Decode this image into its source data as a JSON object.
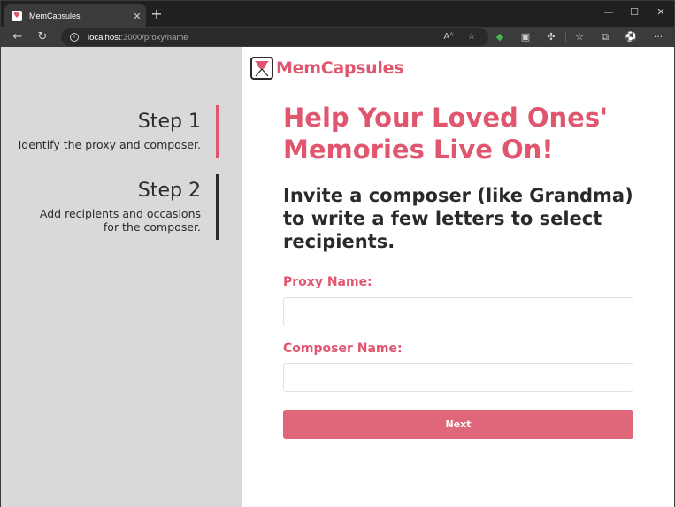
{
  "browser": {
    "tab_title": "MemCapsules",
    "tab_close": "✕",
    "new_tab": "+",
    "window_controls": {
      "minimize": "—",
      "maximize": "☐",
      "close": "✕"
    },
    "nav": {
      "back": "←",
      "refresh": "↻"
    },
    "url_host": "localhost",
    "url_path": ":3000/proxy/name",
    "more_menu": "···"
  },
  "sidebar": {
    "steps": [
      {
        "title": "Step 1",
        "description": "Identify the proxy and composer.",
        "active": true
      },
      {
        "title": "Step 2",
        "description": "Add recipients and occasions for the composer.",
        "active": false
      }
    ]
  },
  "main": {
    "brand": "MemCapsules",
    "hero": "Help Your Loved Ones' Memories Live On!",
    "subtitle": "Invite a composer (like Grandma) to write a few letters to select recipients.",
    "form": {
      "proxy_label": "Proxy Name:",
      "proxy_value": "",
      "composer_label": "Composer Name:",
      "composer_value": "",
      "next_label": "Next"
    }
  },
  "colors": {
    "accent": "#e0566f",
    "button": "#e06679",
    "sidebar_bg": "#d9d9d9",
    "text_dark": "#2a2a2a"
  }
}
